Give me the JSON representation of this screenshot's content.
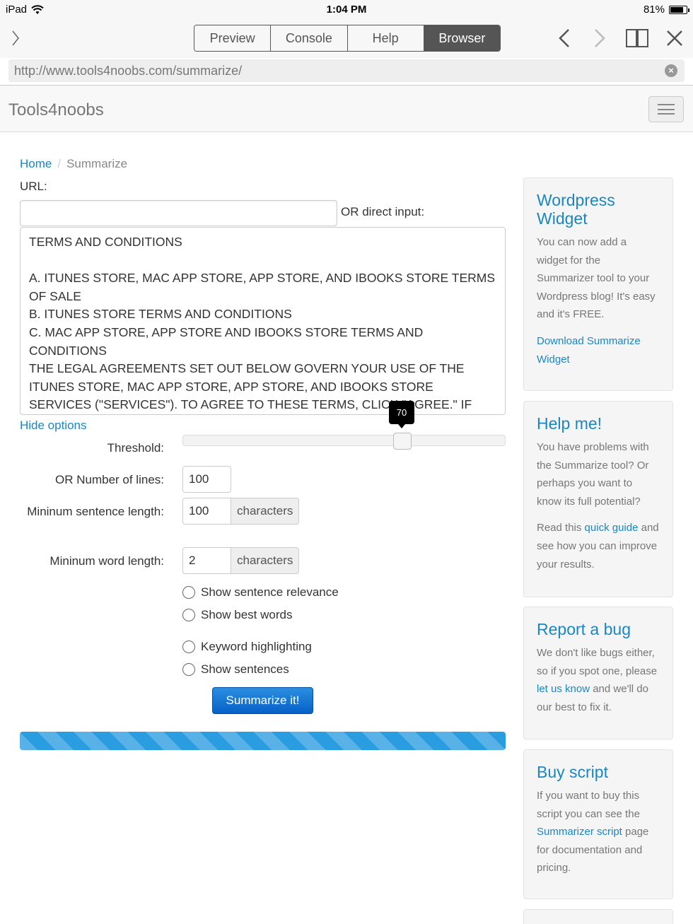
{
  "status_bar": {
    "device": "iPad",
    "time": "1:04 PM",
    "battery": "81%",
    "battery_level": 0.81
  },
  "app_toolbar": {
    "tabs": [
      {
        "label": "Preview",
        "active": false
      },
      {
        "label": "Console",
        "active": false
      },
      {
        "label": "Help",
        "active": false
      },
      {
        "label": "Browser",
        "active": true
      }
    ],
    "icons": [
      "back-arrow-icon",
      "forward-arrow-icon",
      "bookmarks-book-icon",
      "close-icon"
    ]
  },
  "address_bar": {
    "url": "http://www.tools4noobs.com/summarize/"
  },
  "site": {
    "brand": "Tools4noobs"
  },
  "breadcrumb": {
    "home": "Home",
    "separator": "/",
    "current": "Summarize"
  },
  "form": {
    "url_label": "URL:",
    "url_value": "",
    "direct_input_label": "OR direct input:",
    "direct_input_text": "TERMS AND CONDITIONS\n\nA. ITUNES STORE, MAC APP STORE, APP STORE, AND IBOOKS STORE TERMS OF SALE\nB. ITUNES STORE TERMS AND CONDITIONS\nC. MAC APP STORE, APP STORE AND IBOOKS STORE TERMS AND CONDITIONS\nTHE LEGAL AGREEMENTS SET OUT BELOW GOVERN YOUR USE OF THE ITUNES STORE, MAC APP STORE, APP STORE, AND IBOOKS STORE SERVICES (\"SERVICES\"). TO AGREE TO THESE TERMS, CLICK \"AGREE.\" IF",
    "hide_options": "Hide options",
    "threshold_label": "Threshold:",
    "threshold_value": "70",
    "threshold_fraction": 0.7,
    "lines_label": "OR Number of lines:",
    "lines_value": "100",
    "min_sentence_label": "Mininum sentence length:",
    "min_sentence_value": "100",
    "min_word_label": "Mininum word length:",
    "min_word_value": "2",
    "characters_addon": "characters",
    "checkboxes": [
      {
        "label": "Show sentence relevance",
        "checked": false
      },
      {
        "label": "Show best words",
        "checked": false
      },
      {
        "label": "Keyword highlighting",
        "checked": false
      },
      {
        "label": "Show sentences",
        "checked": false
      }
    ],
    "submit_label": "Summarize it!"
  },
  "sidebar": {
    "wordpress": {
      "title": "Wordpress Widget",
      "text": "You can now add a widget for the Summarizer tool to your Wordpress blog! It's easy and it's FREE.",
      "link": "Download Summarize Widget"
    },
    "help": {
      "title": "Help me!",
      "text": "You have problems with the Summarize tool? Or perhaps you want to know its full potential?",
      "text2_before": "Read this ",
      "text2_link": "quick guide",
      "text2_after": " and see how you can improve your results."
    },
    "bug": {
      "title": "Report a bug",
      "text_before": "We don't like bugs either, so if you spot one, please ",
      "text_link": "let us know",
      "text_after": " and we'll do our best to fix it."
    },
    "buy": {
      "title": "Buy script",
      "text_before": "If you want to buy this script you can see the ",
      "text_link": "Summarizer script",
      "text_after": " page for documentation and pricing."
    }
  },
  "colors": {
    "link": "#1a87c4",
    "primary_button": "#0760c7",
    "progress": "#2a9ce0",
    "active_tab": "#555555"
  }
}
